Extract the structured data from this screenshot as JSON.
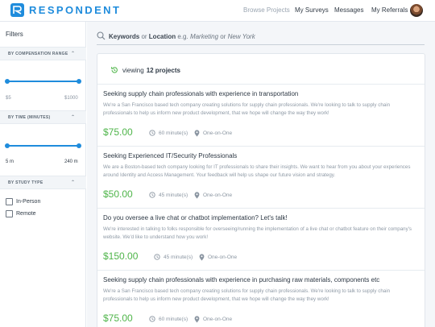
{
  "brand": {
    "name": "RESPONDENT"
  },
  "nav": {
    "browse": "Browse Projects",
    "surveys": "My Surveys",
    "messages": "Messages",
    "referrals": "My Referrals"
  },
  "sidebar": {
    "title": "Filters",
    "compensation": {
      "header": "BY COMPENSATION RANGE",
      "min": "$5",
      "max": "$1000"
    },
    "time": {
      "header": "BY TIME (MINUTES)",
      "min": "5 m",
      "max": "240 m"
    },
    "study_type": {
      "header": "BY STUDY TYPE",
      "options": [
        "In-Person",
        "Remote"
      ]
    }
  },
  "search": {
    "keywords": "Keywords",
    "or1": " or ",
    "location": "Location",
    "eg": " e.g. ",
    "ex1": "Marketing",
    "or2": " or ",
    "ex2": "New York"
  },
  "results": {
    "prefix": "viewing",
    "count": "12 projects"
  },
  "projects": [
    {
      "title": "Seeking supply chain professionals with experience in transportation",
      "desc": "We're a San Francisco based tech company creating solutions for supply chain professionals. We're looking to talk to supply chain professionals to help us inform new product development, that we hope will change the way they work!",
      "price": "$75.00",
      "duration": "60 minute(s)",
      "format": "One-on-One"
    },
    {
      "title": "Seeking Experienced IT/Security Professionals",
      "desc": "We are a Boston-based tech company looking for IT professionals to share their insights. We want to hear from you about your experiences around Identity and Access Management. Your feedback will help us shape our future vision and strategy.",
      "price": "$50.00",
      "duration": "45 minute(s)",
      "format": "One-on-One"
    },
    {
      "title": "Do you oversee a live chat or chatbot implementation? Let's talk!",
      "desc": "We're interested in talking to folks responsible for overseeing/running the implementation of a live chat or chatbot feature on their company's website. We'd like to understand how you work!",
      "price": "$150.00",
      "duration": "45 minute(s)",
      "format": "One-on-One"
    },
    {
      "title": "Seeking supply chain professionals with experience in purchasing raw materials, components etc",
      "desc": "We're a San Francisco based tech company creating solutions for supply chain professionals. We're looking to talk to supply chain professionals to help us inform new product development, that we hope will change the way they work!",
      "price": "$75.00",
      "duration": "60 minute(s)",
      "format": "One-on-One"
    }
  ],
  "colors": {
    "accent": "#1f8cdc",
    "price": "#4fb54a"
  }
}
